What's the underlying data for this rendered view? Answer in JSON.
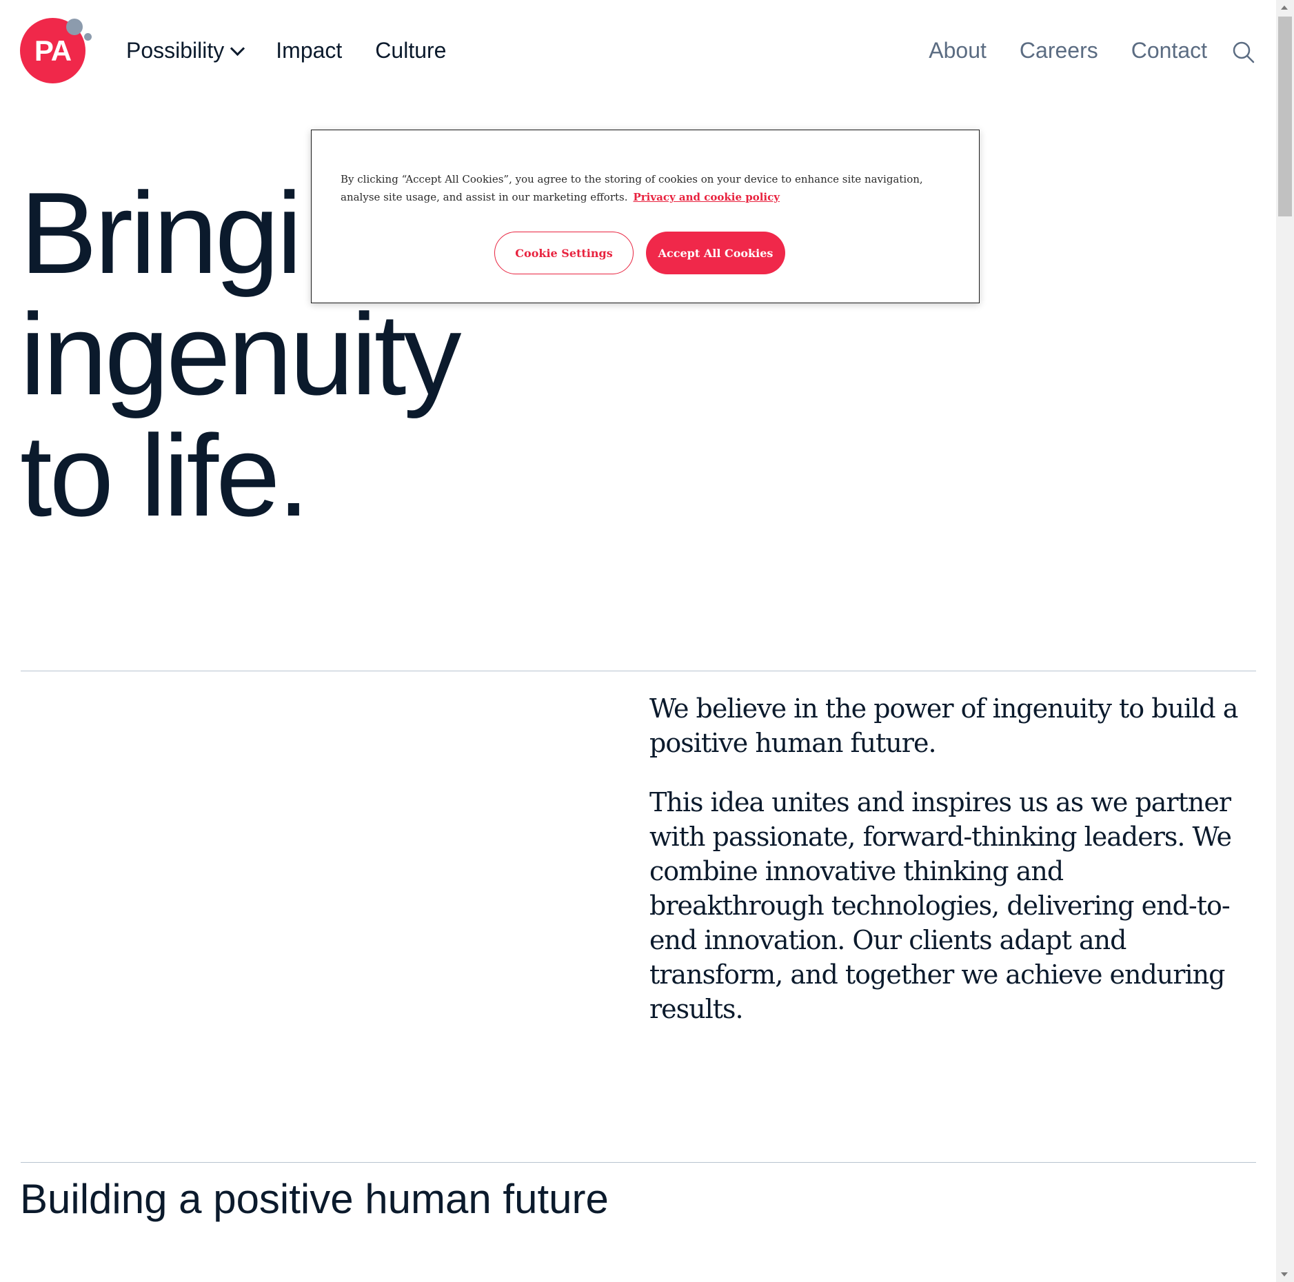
{
  "brand": {
    "logo_text": "PA",
    "accent_color": "#f0284a",
    "text_color": "#0b1a2c",
    "muted_nav_color": "#5b6c82"
  },
  "header": {
    "nav_left": [
      {
        "label": "Possibility",
        "has_dropdown": true,
        "icon": "chevron-down-icon"
      },
      {
        "label": "Impact"
      },
      {
        "label": "Culture"
      }
    ],
    "nav_right": [
      {
        "label": "About"
      },
      {
        "label": "Careers"
      },
      {
        "label": "Contact"
      }
    ],
    "search_icon": "search-icon"
  },
  "hero": {
    "lines": [
      "Bringi",
      "ingenuity",
      "to life."
    ]
  },
  "intro": {
    "lead": "We believe in the power of ingenuity to build a positive human future.",
    "body": "This idea unites and inspires us as we partner with passionate, forward-thinking leaders. We combine innovative thinking and breakthrough technologies, delivering end-to-end innovation. Our clients adapt and transform, and together we achieve enduring results."
  },
  "section": {
    "heading": "Building a positive human future"
  },
  "cookie_banner": {
    "text": "By clicking “Accept All Cookies”, you agree to the storing of cookies on your device to enhance site navigation, analyse site usage, and assist in our marketing efforts.",
    "policy_link": "Privacy and cookie policy",
    "settings_label": "Cookie Settings",
    "accept_label": "Accept All Cookies"
  }
}
